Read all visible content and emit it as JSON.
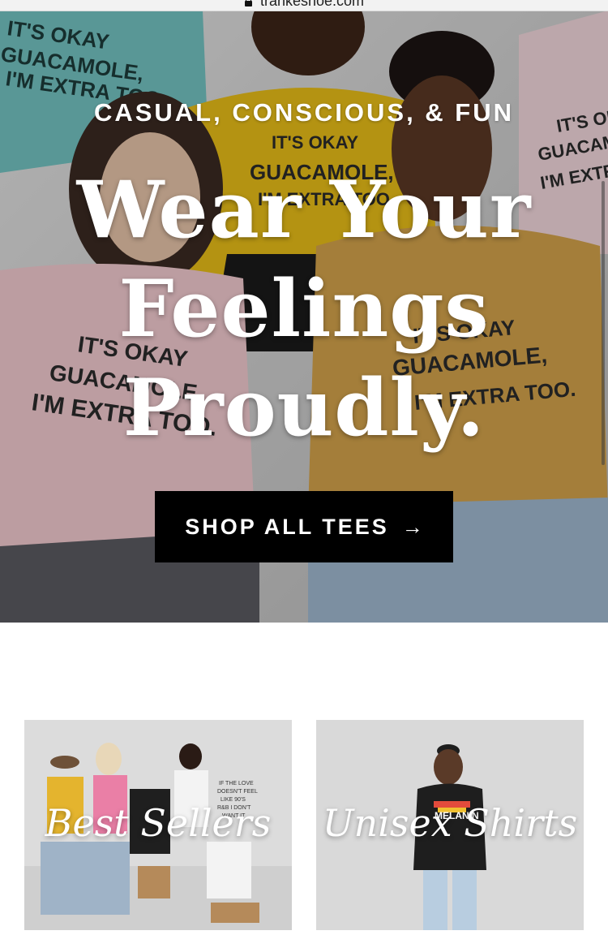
{
  "browser": {
    "url": "trankeshoe.com",
    "lock_icon": "lock-icon"
  },
  "hero": {
    "kicker": "CASUAL, CONSCIOUS, & FUN",
    "title_lines": [
      "Wear Your",
      "Feelings",
      "Proudly."
    ],
    "shirt_text_lines": [
      "IT'S OKAY",
      "GUACAMOLE,",
      "I'M EXTRA TOO."
    ],
    "cta": {
      "label": "SHOP ALL TEES",
      "arrow_icon": "arrow-right-icon"
    },
    "colors": {
      "cta_background": "#000000",
      "cta_text": "#ffffff",
      "mustard_tee": "#d3a24b",
      "pink_tee": "#f1c9cf",
      "teal_tee": "#73c2c0",
      "yellow_tee": "#e7bd18"
    }
  },
  "collections": [
    {
      "label": "Best Sellers"
    },
    {
      "label": "Unisex Shirts"
    }
  ],
  "tile_shirt_text": [
    "IF THE LOVE",
    "DOESN'T FEEL",
    "LIKE 90'S",
    "R&B I DON'T",
    "WANT IT"
  ],
  "tile_graphic_text": "MELANIN"
}
